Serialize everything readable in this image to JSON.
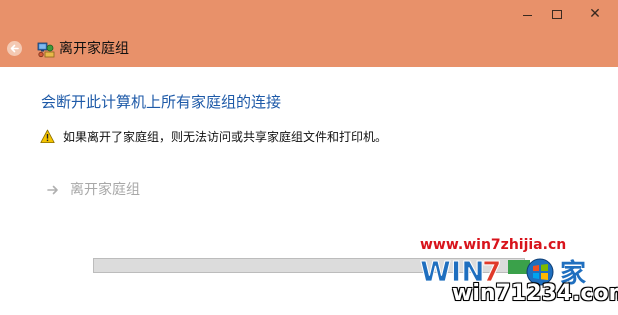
{
  "window": {
    "title": "离开家庭组",
    "titlebar_color": "#e8916a",
    "controls": {
      "minimize_icon": "minimize-icon",
      "maximize_icon": "maximize-icon",
      "close_glyph": "✕"
    }
  },
  "nav": {
    "back_icon": "back-arrow-icon"
  },
  "content": {
    "heading": "会断开此计算机上所有家庭组的连接",
    "heading_color": "#1e5aa8",
    "warning": {
      "icon": "warning-icon",
      "text": "如果离开了家庭组，则无法访问或共享家庭组文件和打印机。"
    },
    "leave_option": {
      "icon": "arrow-right-icon",
      "label": "离开家庭组"
    },
    "progress": {
      "value": 0
    }
  },
  "watermark": {
    "url": "www.win7zhijia.cn",
    "logo_text": "WIN7",
    "site": "win71234.com",
    "url_color": "#d8141c"
  }
}
